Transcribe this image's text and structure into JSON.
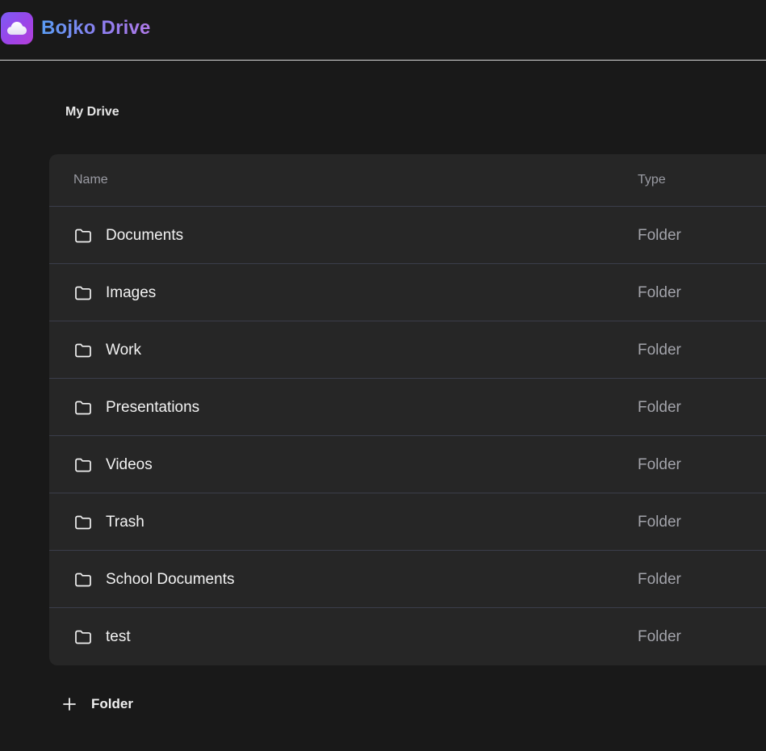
{
  "header": {
    "brand": "Bojko Drive",
    "logo_icon": "cloud-icon",
    "brand_gradient": [
      "#5a9cf3",
      "#b07ae8"
    ]
  },
  "breadcrumb": {
    "current": "My Drive"
  },
  "table": {
    "columns": {
      "name": "Name",
      "type": "Type"
    },
    "rows": [
      {
        "name": "Documents",
        "type": "Folder",
        "icon": "folder-icon"
      },
      {
        "name": "Images",
        "type": "Folder",
        "icon": "folder-icon"
      },
      {
        "name": "Work",
        "type": "Folder",
        "icon": "folder-icon"
      },
      {
        "name": "Presentations",
        "type": "Folder",
        "icon": "folder-icon"
      },
      {
        "name": "Videos",
        "type": "Folder",
        "icon": "folder-icon"
      },
      {
        "name": "Trash",
        "type": "Folder",
        "icon": "folder-icon"
      },
      {
        "name": "School Documents",
        "type": "Folder",
        "icon": "folder-icon"
      },
      {
        "name": "test",
        "type": "Folder",
        "icon": "folder-icon"
      }
    ]
  },
  "actions": {
    "add_folder_label": "Folder",
    "add_folder_icon": "plus-icon"
  },
  "colors": {
    "background": "#191919",
    "table_background": "#262626",
    "row_divider": "#3b3d4a",
    "muted_text": "#a3a4ab",
    "accent": "#9b44e8"
  }
}
